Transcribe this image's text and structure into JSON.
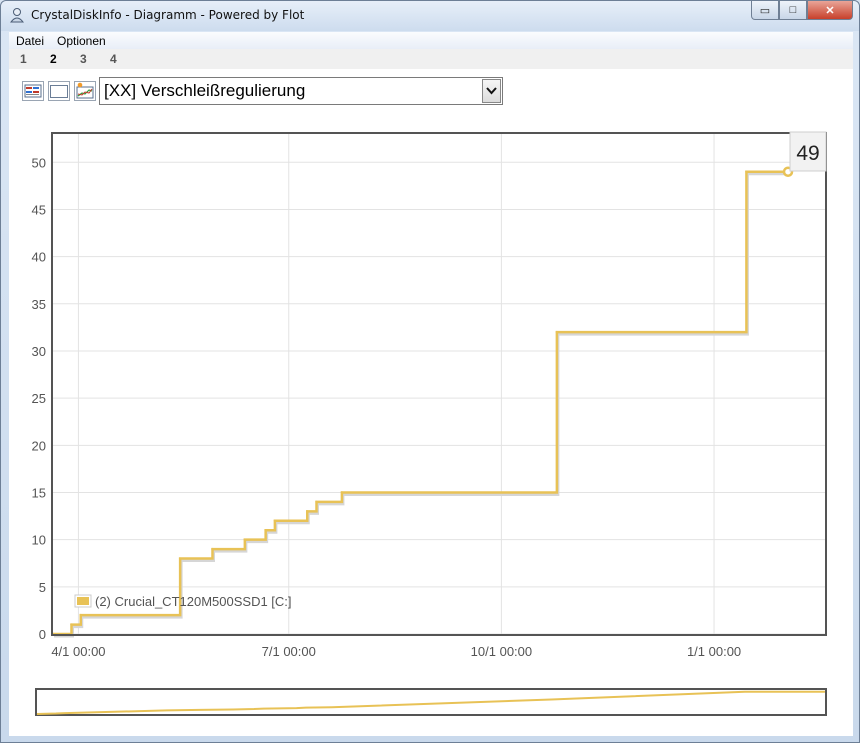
{
  "window": {
    "title": "CrystalDiskInfo - Diagramm - Powered by Flot",
    "minimize_glyph": "▭",
    "maximize_glyph": "□",
    "close_glyph": "✕"
  },
  "menu": {
    "items": [
      {
        "label": "Datei"
      },
      {
        "label": "Optionen"
      }
    ]
  },
  "tabs": [
    {
      "label": "1",
      "active": false
    },
    {
      "label": "2",
      "active": true
    },
    {
      "label": "3",
      "active": false
    },
    {
      "label": "4",
      "active": false
    }
  ],
  "toolbar": {
    "icons": [
      "legend-toggle-icon",
      "blank-view-icon",
      "chart-settings-icon"
    ],
    "attribute_select": {
      "value": "[XX] Verschleißregulierung"
    }
  },
  "chart_data": {
    "type": "line",
    "step": true,
    "line_color": "#e8c256",
    "x_axis": {
      "type": "time",
      "range": [
        "2013-03-21",
        "2014-02-18"
      ],
      "tick_labels": [
        {
          "date": "2013-04-01",
          "label": "4/1 00:00"
        },
        {
          "date": "2013-07-01",
          "label": "7/1 00:00"
        },
        {
          "date": "2013-10-01",
          "label": "10/1 00:00"
        },
        {
          "date": "2014-01-01",
          "label": "1/1 00:00"
        }
      ]
    },
    "y_axis": {
      "range": [
        0,
        53
      ],
      "ticks": [
        0,
        5,
        10,
        15,
        20,
        25,
        30,
        35,
        40,
        45,
        50
      ]
    },
    "grid": true,
    "legend": {
      "position": "bottom-left"
    },
    "series": [
      {
        "name": "(2) Crucial_CT120M500SSD1 [C:]",
        "points": [
          {
            "x": "2013-03-21",
            "y": 0
          },
          {
            "x": "2013-03-29",
            "y": 1
          },
          {
            "x": "2013-04-02",
            "y": 2
          },
          {
            "x": "2013-05-15",
            "y": 8
          },
          {
            "x": "2013-05-29",
            "y": 9
          },
          {
            "x": "2013-06-12",
            "y": 10
          },
          {
            "x": "2013-06-21",
            "y": 11
          },
          {
            "x": "2013-06-25",
            "y": 12
          },
          {
            "x": "2013-07-09",
            "y": 13
          },
          {
            "x": "2013-07-13",
            "y": 14
          },
          {
            "x": "2013-07-24",
            "y": 15
          },
          {
            "x": "2013-10-25",
            "y": 32
          },
          {
            "x": "2014-01-15",
            "y": 49
          },
          {
            "x": "2014-02-02",
            "y": 49
          }
        ]
      }
    ],
    "last_value_label": "49"
  }
}
